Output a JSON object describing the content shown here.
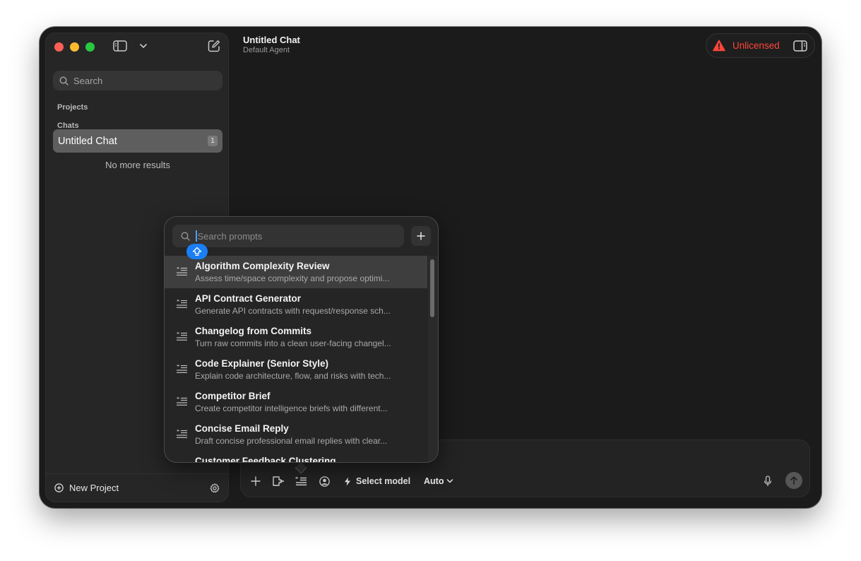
{
  "sidebar": {
    "search_label": "Search",
    "projects_label": "Projects",
    "chats_label": "Chats",
    "chats": [
      {
        "title": "Untitled Chat",
        "badge": "1"
      }
    ],
    "no_more_label": "No more results",
    "new_project_label": "New Project"
  },
  "header": {
    "title": "Untitled Chat",
    "subtitle": "Default Agent",
    "license_status": "Unlicensed",
    "license_color": "#ff453a"
  },
  "popover": {
    "search_placeholder": "Search prompts",
    "search_value": "",
    "prompts": [
      {
        "title": "Algorithm Complexity Review",
        "desc": "Assess time/space complexity and propose optimi...",
        "selected": true
      },
      {
        "title": "API Contract Generator",
        "desc": "Generate API contracts with request/response sch..."
      },
      {
        "title": "Changelog from Commits",
        "desc": "Turn raw commits into a clean user-facing changel..."
      },
      {
        "title": "Code Explainer (Senior Style)",
        "desc": "Explain code architecture, flow, and risks with tech..."
      },
      {
        "title": "Competitor Brief",
        "desc": "Create competitor intelligence briefs with different..."
      },
      {
        "title": "Concise Email Reply",
        "desc": "Draft concise professional email replies with clear..."
      },
      {
        "title": "Customer Feedback Clustering",
        "desc": ""
      }
    ]
  },
  "composer": {
    "model_label": "Select model",
    "auto_label": "Auto"
  },
  "colors": {
    "accent": "#1a7ff4",
    "selection": "#3e3e3e"
  }
}
